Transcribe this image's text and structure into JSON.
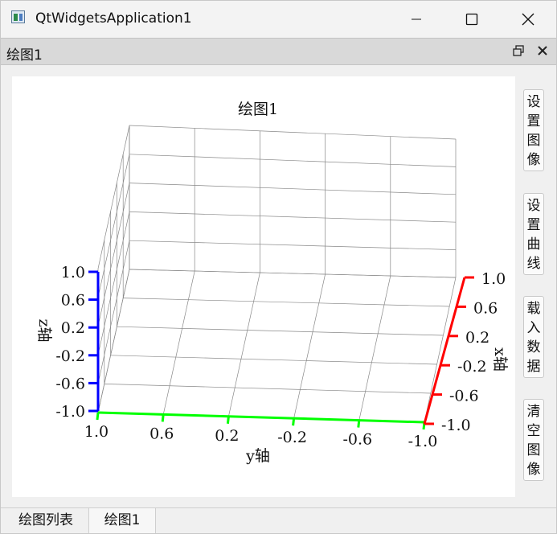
{
  "window": {
    "title": "QtWidgetsApplication1"
  },
  "dock": {
    "title": "绘图1"
  },
  "plot": {
    "title": "绘图1",
    "x_axis_label": "x轴",
    "y_axis_label": "y轴",
    "z_axis_label": "z轴",
    "x_ticks": [
      "1.0",
      "0.6",
      "0.2",
      "-0.2",
      "-0.6",
      "-1.0"
    ],
    "y_ticks": [
      "1.0",
      "0.6",
      "0.2",
      "-0.2",
      "-0.6",
      "-1.0"
    ],
    "z_ticks": [
      "1.0",
      "0.6",
      "0.2",
      "-0.2",
      "-0.6",
      "-1.0"
    ],
    "colors": {
      "x_axis": "#ff0000",
      "y_axis": "#00ff00",
      "z_axis": "#0000ff",
      "grid": "#888888"
    }
  },
  "side_buttons": [
    {
      "chars": [
        "设",
        "置",
        "图",
        "像"
      ]
    },
    {
      "chars": [
        "设",
        "置",
        "曲",
        "线"
      ]
    },
    {
      "chars": [
        "载",
        "入",
        "数",
        "据"
      ]
    },
    {
      "chars": [
        "清",
        "空",
        "图",
        "像"
      ]
    }
  ],
  "tabs": [
    {
      "label": "绘图列表"
    },
    {
      "label": "绘图1"
    }
  ]
}
